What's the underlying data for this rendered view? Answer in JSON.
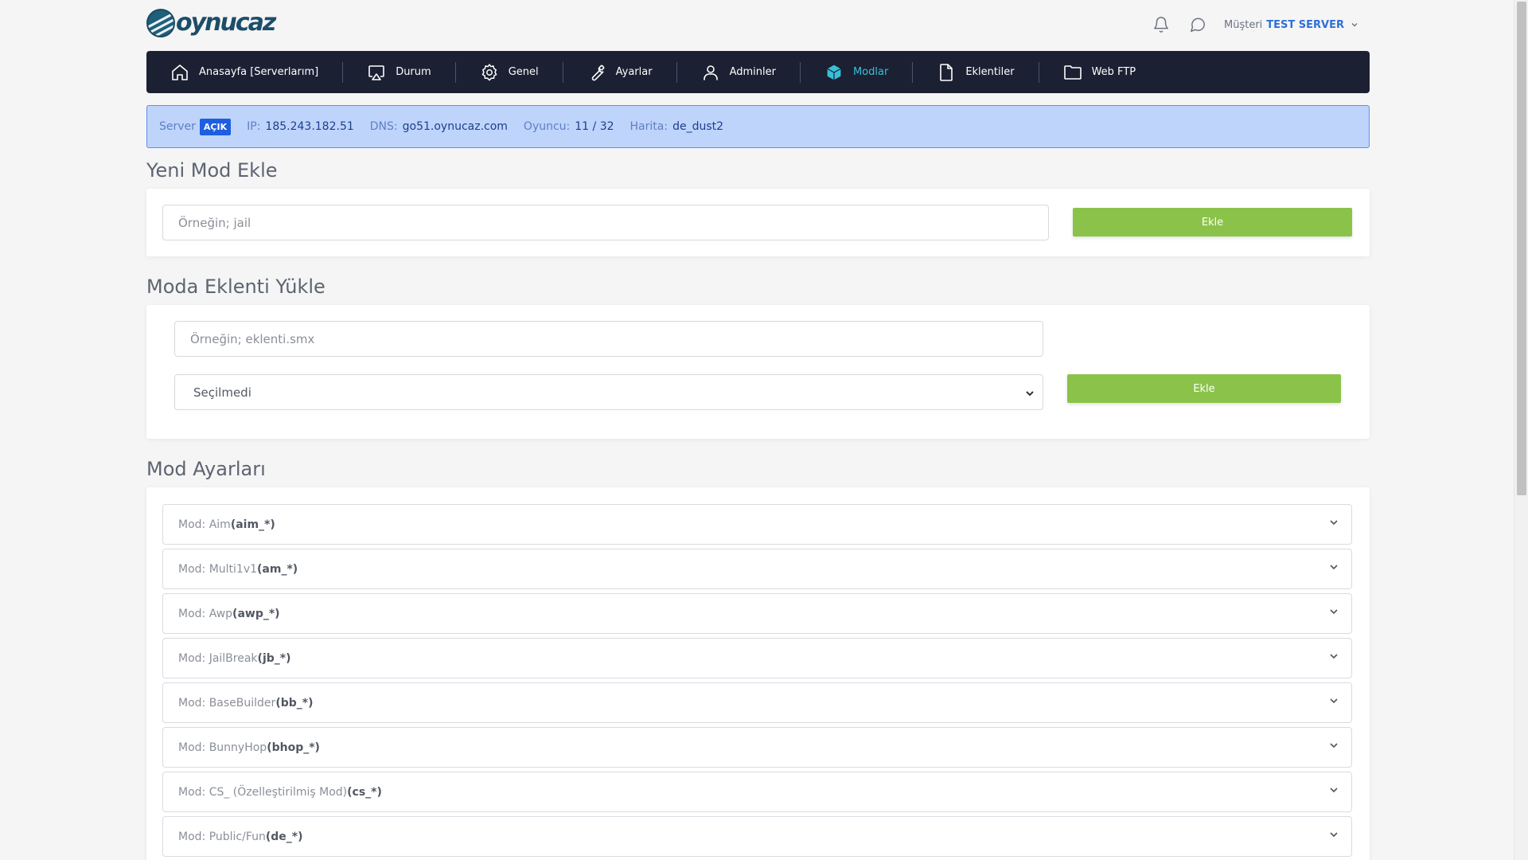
{
  "brand": {
    "name": "oynucaz"
  },
  "header": {
    "user_label": "Müşteri",
    "user_name": "TEST SERVER",
    "icons": [
      "bell-icon",
      "chat-icon",
      "chevron-down-icon"
    ]
  },
  "nav": {
    "items": [
      {
        "label": "Anasayfa [Serverlarım]",
        "icon": "home-icon"
      },
      {
        "label": "Durum",
        "icon": "monitor-icon"
      },
      {
        "label": "Genel",
        "icon": "gear-icon"
      },
      {
        "label": "Ayarlar",
        "icon": "wrench-icon"
      },
      {
        "label": "Adminler",
        "icon": "user-icon"
      },
      {
        "label": "Modlar",
        "icon": "cube-icon",
        "active": true
      },
      {
        "label": "Eklentiler",
        "icon": "file-icon"
      },
      {
        "label": "Web FTP",
        "icon": "folder-icon"
      }
    ],
    "active_color": "#39c0d8",
    "background": "#1b2033"
  },
  "status": {
    "server_label": "Server",
    "server_state": "AÇIK",
    "ip_label": "IP:",
    "ip": "185.243.182.51",
    "dns_label": "DNS:",
    "dns": "go51.oynucaz.com",
    "players_label": "Oyuncu:",
    "players": "11 / 32",
    "map_label": "Harita:",
    "map": "de_dust2"
  },
  "new_mod": {
    "title": "Yeni Mod Ekle",
    "placeholder": "Örneğin; jail",
    "button": "Ekle"
  },
  "upload": {
    "title": "Moda Eklenti Yükle",
    "placeholder": "Örneğin; eklenti.smx",
    "select_value": "Seçilmedi",
    "button": "Ekle"
  },
  "settings": {
    "title": "Mod Ayarları",
    "mods": [
      {
        "prefix": "Mod: Aim",
        "code": "(aim_*)"
      },
      {
        "prefix": "Mod: Multi1v1",
        "code": "(am_*)"
      },
      {
        "prefix": "Mod: Awp",
        "code": "(awp_*)"
      },
      {
        "prefix": "Mod: JailBreak",
        "code": "(jb_*)"
      },
      {
        "prefix": "Mod: BaseBuilder",
        "code": "(bb_*)"
      },
      {
        "prefix": "Mod: BunnyHop",
        "code": "(bhop_*)"
      },
      {
        "prefix": "Mod: CS_ (Özelleştirilmiş Mod)",
        "code": "(cs_*)"
      },
      {
        "prefix": "Mod: Public/Fun",
        "code": "(de_*)"
      }
    ]
  },
  "colors": {
    "accent_green": "#8bc34a",
    "status_bg": "#bfd4fb",
    "badge": "#1d5fe0"
  }
}
